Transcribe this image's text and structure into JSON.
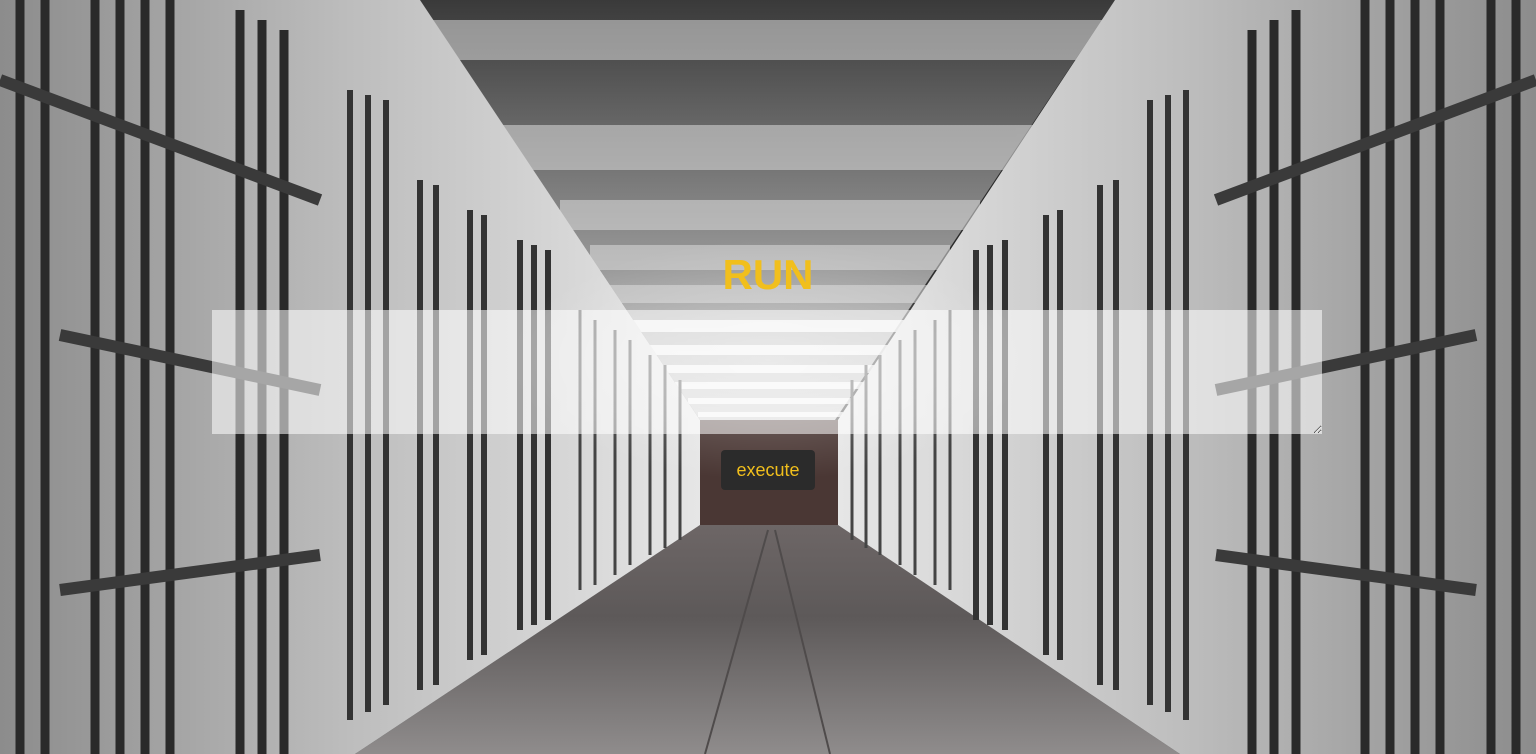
{
  "page": {
    "title": "RUN",
    "code_input": {
      "value": "",
      "placeholder": ""
    },
    "execute_label": "execute"
  },
  "colors": {
    "accent": "#f1bf1c",
    "button_bg": "#2b2b2b",
    "input_bg": "rgba(255,255,255,0.55)"
  },
  "background": {
    "description_icon": "prison-corridor-image"
  }
}
